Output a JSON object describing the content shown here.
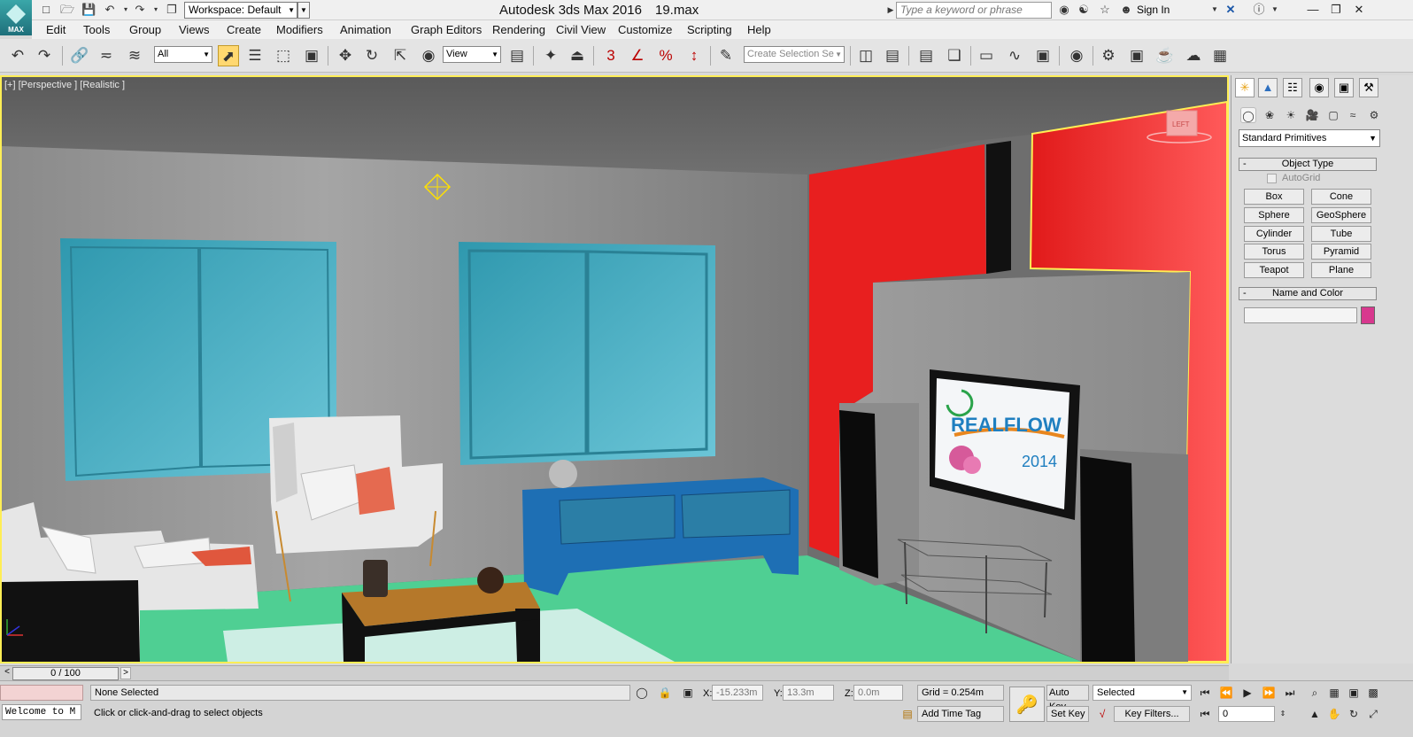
{
  "titlebar": {
    "logo_text": "MAX",
    "workspace": "Workspace: Default",
    "app_title": "Autodesk 3ds Max 2016",
    "file_name": "19.max",
    "search_placeholder": "Type a keyword or phrase",
    "sign_in": "Sign In"
  },
  "menu": [
    "Edit",
    "Tools",
    "Group",
    "Views",
    "Create",
    "Modifiers",
    "Animation",
    "Graph Editors",
    "Rendering",
    "Civil View",
    "Customize",
    "Scripting",
    "Help"
  ],
  "toolbar": {
    "selection_filter": "All",
    "ref_coord": "View",
    "snap_count": "3",
    "named_selection_placeholder": "Create Selection Se"
  },
  "viewport": {
    "label": "[+] [Perspective ] [Realistic ]",
    "viewcube_label": "LEFT",
    "tv_brand": "REALFLOW",
    "tv_year": "2014"
  },
  "command_panel": {
    "category": "Standard Primitives",
    "object_type_header": "Object Type",
    "autogrid_label": "AutoGrid",
    "primitives": [
      "Box",
      "Cone",
      "Sphere",
      "GeoSphere",
      "Cylinder",
      "Tube",
      "Torus",
      "Pyramid",
      "Teapot",
      "Plane"
    ],
    "name_color_header": "Name and Color",
    "object_color": "#d8388e"
  },
  "timeline": {
    "frame_display": "0 / 100"
  },
  "status": {
    "selection": "None Selected",
    "prompt": "Click or click-and-drag to select objects",
    "maxscript_listener": "Welcome to M",
    "x_label": "X:",
    "x_value": "-15.233m",
    "y_label": "Y:",
    "y_value": "13.3m",
    "z_label": "Z:",
    "z_value": "0.0m",
    "grid": "Grid = 0.254m",
    "add_time_tag": "Add Time Tag",
    "auto_key": "Auto Key",
    "set_key": "Set Key",
    "key_mode": "Selected",
    "key_filters": "Key Filters...",
    "current_frame": "0"
  },
  "colors": {
    "viewport_border": "#ffee55",
    "wall_red": "#e81f1f",
    "floor_green": "#4fcf93",
    "window_teal": "#3fa8bd",
    "tv_stand_blue": "#1e6fb4"
  }
}
